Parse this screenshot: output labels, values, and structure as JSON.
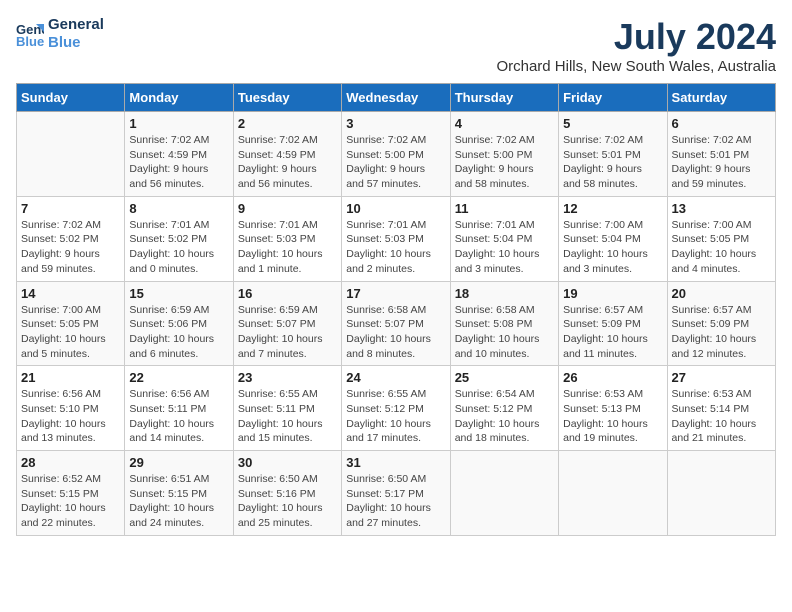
{
  "logo": {
    "line1": "General",
    "line2": "Blue"
  },
  "title": "July 2024",
  "subtitle": "Orchard Hills, New South Wales, Australia",
  "days_header": [
    "Sunday",
    "Monday",
    "Tuesday",
    "Wednesday",
    "Thursday",
    "Friday",
    "Saturday"
  ],
  "weeks": [
    [
      {
        "num": "",
        "info": ""
      },
      {
        "num": "1",
        "info": "Sunrise: 7:02 AM\nSunset: 4:59 PM\nDaylight: 9 hours\nand 56 minutes."
      },
      {
        "num": "2",
        "info": "Sunrise: 7:02 AM\nSunset: 4:59 PM\nDaylight: 9 hours\nand 56 minutes."
      },
      {
        "num": "3",
        "info": "Sunrise: 7:02 AM\nSunset: 5:00 PM\nDaylight: 9 hours\nand 57 minutes."
      },
      {
        "num": "4",
        "info": "Sunrise: 7:02 AM\nSunset: 5:00 PM\nDaylight: 9 hours\nand 58 minutes."
      },
      {
        "num": "5",
        "info": "Sunrise: 7:02 AM\nSunset: 5:01 PM\nDaylight: 9 hours\nand 58 minutes."
      },
      {
        "num": "6",
        "info": "Sunrise: 7:02 AM\nSunset: 5:01 PM\nDaylight: 9 hours\nand 59 minutes."
      }
    ],
    [
      {
        "num": "7",
        "info": "Sunrise: 7:02 AM\nSunset: 5:02 PM\nDaylight: 9 hours\nand 59 minutes."
      },
      {
        "num": "8",
        "info": "Sunrise: 7:01 AM\nSunset: 5:02 PM\nDaylight: 10 hours\nand 0 minutes."
      },
      {
        "num": "9",
        "info": "Sunrise: 7:01 AM\nSunset: 5:03 PM\nDaylight: 10 hours\nand 1 minute."
      },
      {
        "num": "10",
        "info": "Sunrise: 7:01 AM\nSunset: 5:03 PM\nDaylight: 10 hours\nand 2 minutes."
      },
      {
        "num": "11",
        "info": "Sunrise: 7:01 AM\nSunset: 5:04 PM\nDaylight: 10 hours\nand 3 minutes."
      },
      {
        "num": "12",
        "info": "Sunrise: 7:00 AM\nSunset: 5:04 PM\nDaylight: 10 hours\nand 3 minutes."
      },
      {
        "num": "13",
        "info": "Sunrise: 7:00 AM\nSunset: 5:05 PM\nDaylight: 10 hours\nand 4 minutes."
      }
    ],
    [
      {
        "num": "14",
        "info": "Sunrise: 7:00 AM\nSunset: 5:05 PM\nDaylight: 10 hours\nand 5 minutes."
      },
      {
        "num": "15",
        "info": "Sunrise: 6:59 AM\nSunset: 5:06 PM\nDaylight: 10 hours\nand 6 minutes."
      },
      {
        "num": "16",
        "info": "Sunrise: 6:59 AM\nSunset: 5:07 PM\nDaylight: 10 hours\nand 7 minutes."
      },
      {
        "num": "17",
        "info": "Sunrise: 6:58 AM\nSunset: 5:07 PM\nDaylight: 10 hours\nand 8 minutes."
      },
      {
        "num": "18",
        "info": "Sunrise: 6:58 AM\nSunset: 5:08 PM\nDaylight: 10 hours\nand 10 minutes."
      },
      {
        "num": "19",
        "info": "Sunrise: 6:57 AM\nSunset: 5:09 PM\nDaylight: 10 hours\nand 11 minutes."
      },
      {
        "num": "20",
        "info": "Sunrise: 6:57 AM\nSunset: 5:09 PM\nDaylight: 10 hours\nand 12 minutes."
      }
    ],
    [
      {
        "num": "21",
        "info": "Sunrise: 6:56 AM\nSunset: 5:10 PM\nDaylight: 10 hours\nand 13 minutes."
      },
      {
        "num": "22",
        "info": "Sunrise: 6:56 AM\nSunset: 5:11 PM\nDaylight: 10 hours\nand 14 minutes."
      },
      {
        "num": "23",
        "info": "Sunrise: 6:55 AM\nSunset: 5:11 PM\nDaylight: 10 hours\nand 15 minutes."
      },
      {
        "num": "24",
        "info": "Sunrise: 6:55 AM\nSunset: 5:12 PM\nDaylight: 10 hours\nand 17 minutes."
      },
      {
        "num": "25",
        "info": "Sunrise: 6:54 AM\nSunset: 5:12 PM\nDaylight: 10 hours\nand 18 minutes."
      },
      {
        "num": "26",
        "info": "Sunrise: 6:53 AM\nSunset: 5:13 PM\nDaylight: 10 hours\nand 19 minutes."
      },
      {
        "num": "27",
        "info": "Sunrise: 6:53 AM\nSunset: 5:14 PM\nDaylight: 10 hours\nand 21 minutes."
      }
    ],
    [
      {
        "num": "28",
        "info": "Sunrise: 6:52 AM\nSunset: 5:15 PM\nDaylight: 10 hours\nand 22 minutes."
      },
      {
        "num": "29",
        "info": "Sunrise: 6:51 AM\nSunset: 5:15 PM\nDaylight: 10 hours\nand 24 minutes."
      },
      {
        "num": "30",
        "info": "Sunrise: 6:50 AM\nSunset: 5:16 PM\nDaylight: 10 hours\nand 25 minutes."
      },
      {
        "num": "31",
        "info": "Sunrise: 6:50 AM\nSunset: 5:17 PM\nDaylight: 10 hours\nand 27 minutes."
      },
      {
        "num": "",
        "info": ""
      },
      {
        "num": "",
        "info": ""
      },
      {
        "num": "",
        "info": ""
      }
    ]
  ]
}
